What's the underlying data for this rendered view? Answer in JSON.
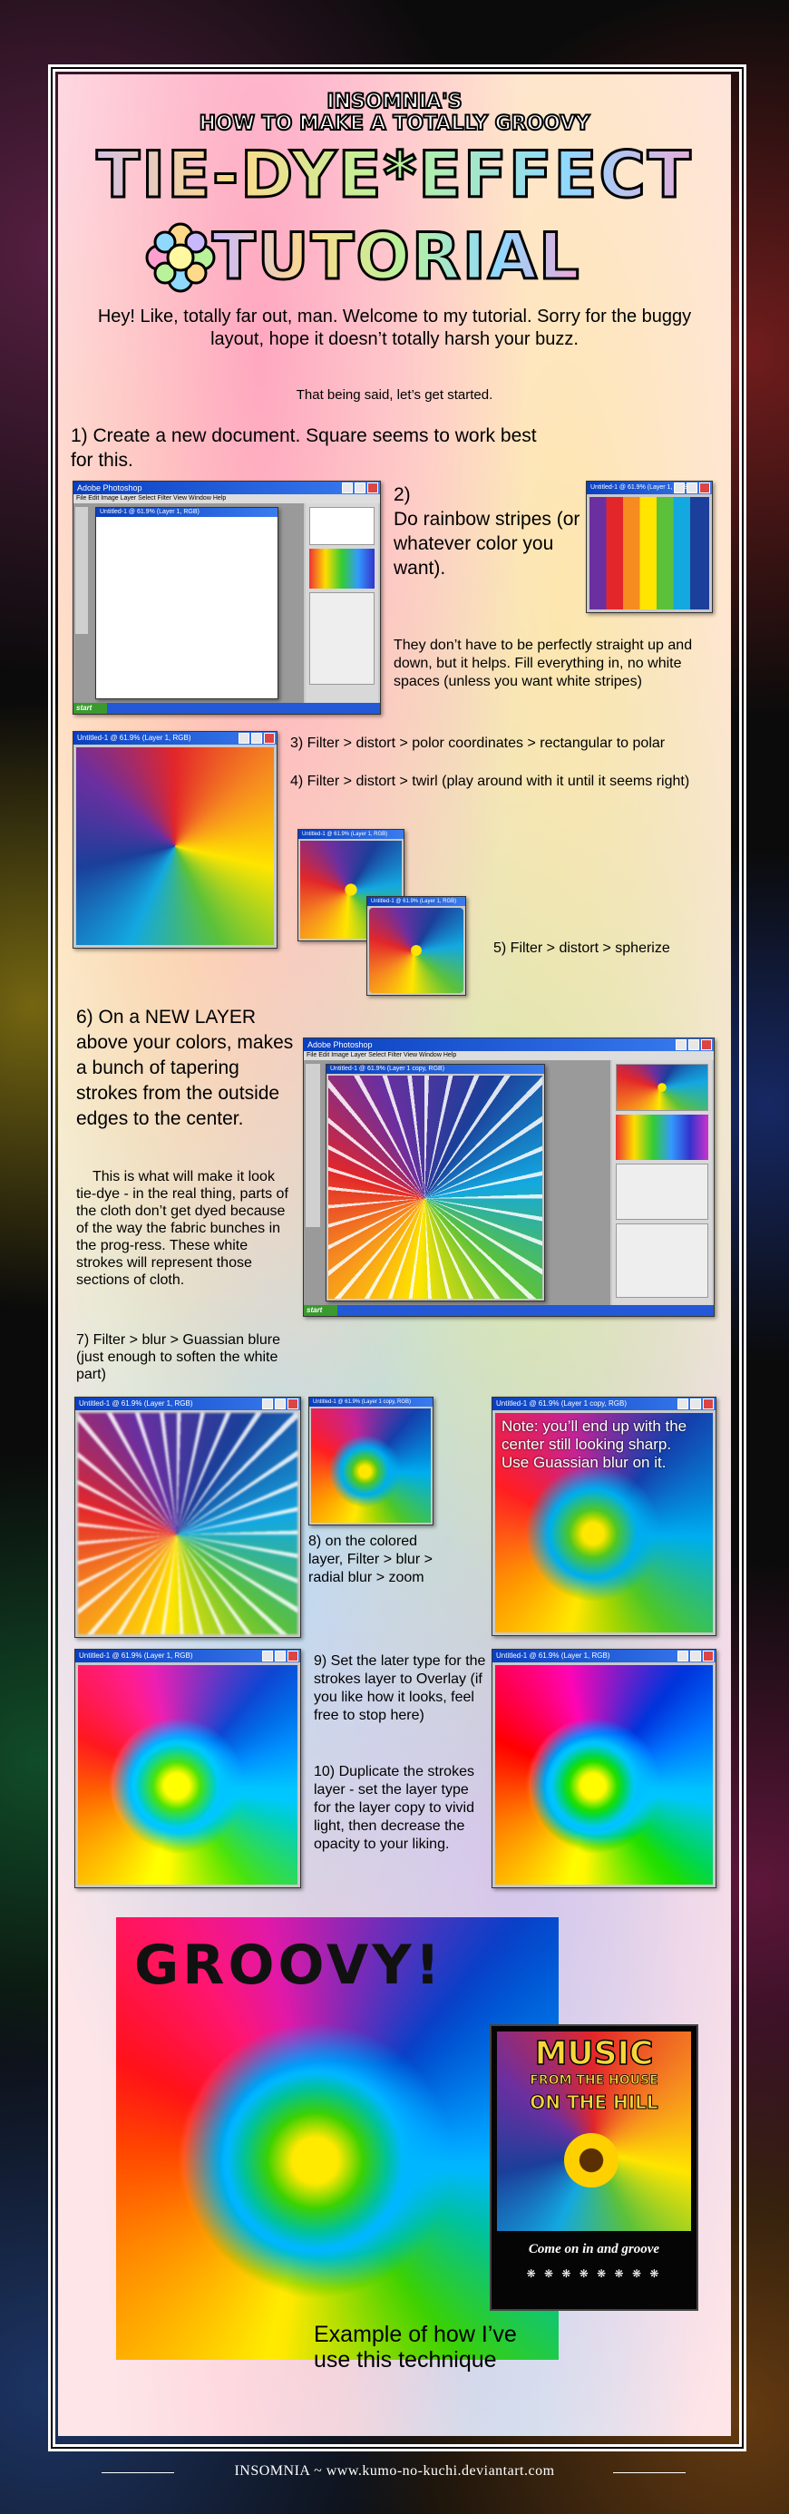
{
  "header": {
    "line1": "INSOMNIA'S",
    "line2": "HOW TO MAKE A TOTALLY GROOVY",
    "title_a": "TIE-DYE*EFFECT",
    "title_b": "TUTORIAL"
  },
  "intro": {
    "welcome": "Hey! Like, totally far out, man. Welcome to my tutorial. Sorry for the buggy layout, hope it doesn’t totally harsh your buzz.",
    "started": "That being said, let’s get started."
  },
  "steps": {
    "s1": "1) Create a new document. Square seems to work best for this.",
    "s2_num": "2)",
    "s2": "Do rainbow stripes (or whatever color you want).",
    "s2_note": "They don’t have to be perfectly straight up and down, but it helps. Fill everything in, no white spaces (unless you want white stripes)",
    "s3": "3) Filter > distort > polor coordinates > rectangular to polar",
    "s4": "4) Filter > distort > twirl (play around with it until it seems right)",
    "s5": "5) Filter > distort > spherize",
    "s6": "6) On a NEW LAYER above your colors, makes a bunch of tapering strokes from the outside edges to the center.",
    "s6_note": "This is what will make it look tie-dye - in the real thing, parts of the cloth don’t get dyed because of the way the fabric bunches in the prog-ress. These white strokes will represent those sections of cloth.",
    "s7": "7) Filter > blur > Guassian blure (just enough to soften the white part)",
    "s8": "8) on the colored layer, Filter > blur > radial blur > zoom",
    "note": "Note: you’ll end up with the center still looking sharp. Use Guassian blur on it.",
    "s9": "9) Set the later type for the strokes layer to Overlay (if you like how it looks, feel free to stop here)",
    "s10": "10) Duplicate the strokes layer - set the layer type for the layer copy to vivid light, then decrease the opacity to your liking."
  },
  "windows": {
    "ps_title": "Adobe Photoshop",
    "doc1": "Untitled-1 @ 61.9% (Layer 1, RGB)",
    "doc2": "Untitled-1 @ 61.9% (Layer 1, RGB)",
    "doc_copy": "Untitled-1 @ 61.9% (Layer 1 copy, RGB)",
    "menu": "File  Edit  Image  Layer  Select  Filter  View  Window  Help",
    "start": "start"
  },
  "final": {
    "groovy": "GROOVY!",
    "poster_title_a": "MUSIC",
    "poster_title_b": "FROM THE HOUSE",
    "poster_title_c": "ON THE HILL",
    "poster_tag": "Come on in and groove",
    "caption": "Example of how I’ve use this technique"
  },
  "footer": "INSOMNIA ~ www.kumo-no-kuchi.deviantart.com"
}
